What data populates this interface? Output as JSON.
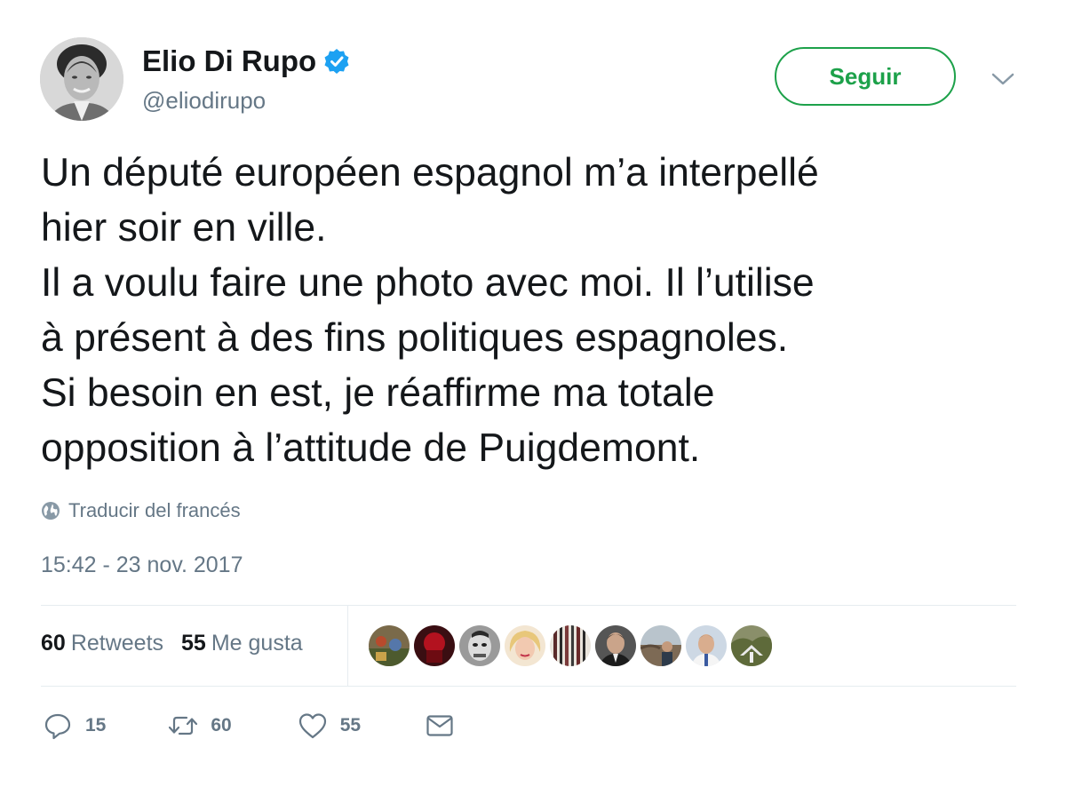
{
  "author": {
    "name": "Elio Di Rupo",
    "handle": "@eliodirupo",
    "verified": true
  },
  "follow_button": {
    "label": "Seguir"
  },
  "tweet": {
    "lines": [
      "Un député européen espagnol m’a interpellé",
      "hier soir en ville.",
      "Il a voulu faire une photo avec moi. Il l’utilise",
      "à présent à des fins politiques espagnoles.",
      "Si besoin en est, je réaffirme ma totale",
      "opposition à l’attitude de Puigdemont."
    ],
    "translate_label": "Traducir del francés",
    "timestamp": "15:42 - 23 nov. 2017"
  },
  "stats": {
    "retweets_count": "60",
    "retweets_label": "Retweets",
    "likes_count": "55",
    "likes_label": "Me gusta"
  },
  "actions": {
    "reply": {
      "icon": "reply-icon",
      "count": "15"
    },
    "retweet": {
      "icon": "retweet-icon",
      "count": "60"
    },
    "like": {
      "icon": "heart-icon",
      "count": "55"
    },
    "message": {
      "icon": "envelope-icon"
    }
  },
  "colors": {
    "follow_green": "#1da14a",
    "verified_blue": "#1da1f2",
    "muted_gray": "#657786",
    "text": "#14171a"
  }
}
